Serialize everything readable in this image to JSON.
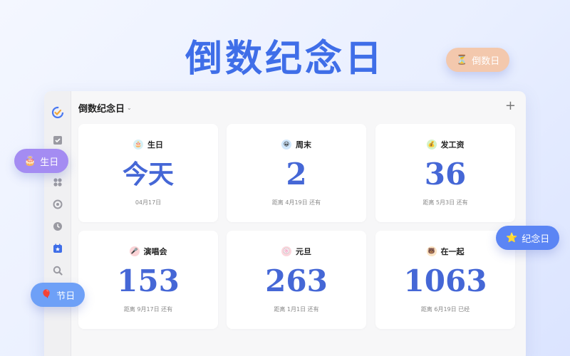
{
  "hero_title": "倒数纪念日",
  "floating_tags": {
    "countdown": {
      "icon": "⏳",
      "label": "倒数日",
      "color": "#f3c8ad"
    },
    "birthday": {
      "icon": "🎂",
      "label": "生日",
      "color": "#a48cf2"
    },
    "anniversary": {
      "icon": "⭐",
      "label": "纪念日",
      "color": "#5b85f4"
    },
    "holiday": {
      "icon": "🎈",
      "label": "节日",
      "color": "#6ea0f7"
    }
  },
  "header": {
    "title": "倒数纪念日",
    "chevron": "⌄",
    "add": "+"
  },
  "cards": [
    {
      "name": "生日",
      "icon": "🎂",
      "icon_bg": "#d6f0f5",
      "value": "今天",
      "sub": "04月17日"
    },
    {
      "name": "周末",
      "icon": "😀",
      "icon_bg": "#cfe6fb",
      "value": "2",
      "sub": "距离 4月19日 还有"
    },
    {
      "name": "发工资",
      "icon": "💰",
      "icon_bg": "#d5f2c8",
      "value": "36",
      "sub": "距离 5月3日 还有"
    },
    {
      "name": "演唱会",
      "icon": "🎤",
      "icon_bg": "#fbd3d6",
      "value": "153",
      "sub": "距离 9月17日 还有"
    },
    {
      "name": "元旦",
      "icon": "🍥",
      "icon_bg": "#fbd6dd",
      "value": "263",
      "sub": "距离 1月1日 还有"
    },
    {
      "name": "在一起",
      "icon": "🐻",
      "icon_bg": "#fbe3c3",
      "value": "1063",
      "sub": "距离 6月19日 已经"
    }
  ],
  "colors": {
    "accent": "#4567d6",
    "hero": "#3f6ee8"
  }
}
